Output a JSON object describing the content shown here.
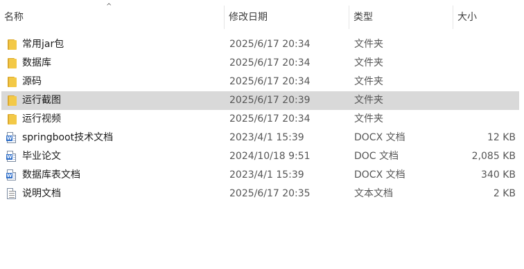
{
  "header": {
    "col_name": "名称",
    "col_date": "修改日期",
    "col_type": "类型",
    "col_size": "大小",
    "sort_indicator": "^"
  },
  "files": [
    {
      "name": "常用jar包",
      "date": "2025/6/17 20:34",
      "type": "文件夹",
      "size": "",
      "icon": "folder-icon",
      "selected": false
    },
    {
      "name": "数据库",
      "date": "2025/6/17 20:34",
      "type": "文件夹",
      "size": "",
      "icon": "folder-icon",
      "selected": false
    },
    {
      "name": "源码",
      "date": "2025/6/17 20:34",
      "type": "文件夹",
      "size": "",
      "icon": "folder-icon",
      "selected": false
    },
    {
      "name": "运行截图",
      "date": "2025/6/17 20:39",
      "type": "文件夹",
      "size": "",
      "icon": "folder-icon",
      "selected": true
    },
    {
      "name": "运行视频",
      "date": "2025/6/17 20:34",
      "type": "文件夹",
      "size": "",
      "icon": "folder-icon",
      "selected": false
    },
    {
      "name": "springboot技术文档",
      "date": "2023/4/1 15:39",
      "type": "DOCX 文档",
      "size": "12 KB",
      "icon": "word-docx-icon",
      "selected": false
    },
    {
      "name": "毕业论文",
      "date": "2024/10/18 9:51",
      "type": "DOC 文档",
      "size": "2,085 KB",
      "icon": "word-doc-icon",
      "selected": false
    },
    {
      "name": "数据库表文档",
      "date": "2023/4/1 15:39",
      "type": "DOCX 文档",
      "size": "340 KB",
      "icon": "word-docx-icon",
      "selected": false
    },
    {
      "name": "说明文档",
      "date": "2025/6/17 20:35",
      "type": "文本文档",
      "size": "2 KB",
      "icon": "text-document-icon",
      "selected": false
    }
  ],
  "colors": {
    "selected_row": "#d9d9d9",
    "folder": "#f3c947",
    "word_blue": "#2b6cc8"
  }
}
